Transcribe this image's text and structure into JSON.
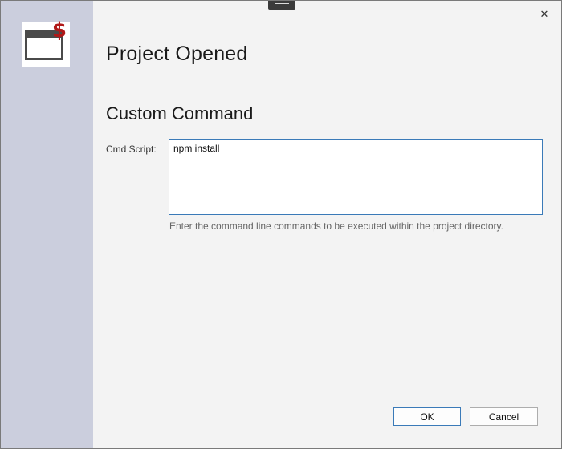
{
  "window": {
    "close_glyph": "✕"
  },
  "sidebar": {
    "app_icon": "terminal-dollar-icon",
    "dollar_glyph": "$"
  },
  "main": {
    "title": "Project Opened",
    "section_title": "Custom Command",
    "cmd_label": "Cmd Script:",
    "cmd_value": "npm install",
    "hint": "Enter the command line commands to be executed within the project directory."
  },
  "buttons": {
    "ok": "OK",
    "cancel": "Cancel"
  },
  "colors": {
    "sidebar": "#cbcedd",
    "background": "#f3f3f3",
    "focus_border": "#3a7ab8",
    "dollar": "#b01818"
  }
}
